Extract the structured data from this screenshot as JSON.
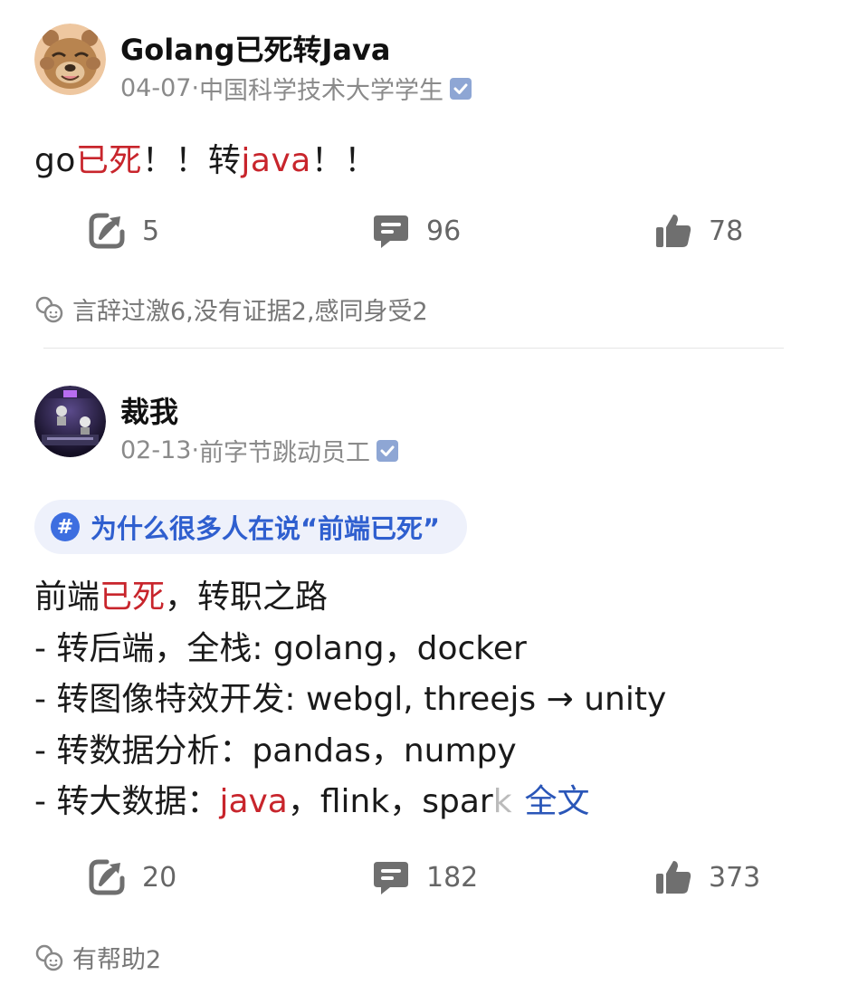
{
  "posts": [
    {
      "author": "Golang已死转Java",
      "date": "04-07",
      "affiliation": "中国科学技术大学学生",
      "content": {
        "seg1": "go",
        "seg2": "已死",
        "seg3": "！！转",
        "seg4": "java",
        "seg5": "！！"
      },
      "stats": {
        "shares": "5",
        "comments": "96",
        "likes": "78"
      },
      "reactions": "言辞过激6,没有证据2,感同身受2"
    },
    {
      "author": "裁我",
      "date": "02-13",
      "affiliation": "前字节跳动员工",
      "topic": "为什么很多人在说“前端已死”",
      "content": {
        "line1_a": "前端",
        "line1_b": "已死",
        "line1_c": "，转职之路",
        "line2": "- 转后端，全栈: golang，docker",
        "line3": "- 转图像特效开发: webgl, threejs → unity",
        "line4": "- 转数据分析：pandas，numpy",
        "line5_a": "- 转大数据：",
        "line5_b": "java",
        "line5_c": "，flink，spar",
        "line5_d": "k",
        "more_label": "全文"
      },
      "stats": {
        "shares": "20",
        "comments": "182",
        "likes": "373"
      },
      "reactions": "有帮助2"
    }
  ],
  "colors": {
    "highlight_red": "#c8252c",
    "link_blue": "#2a56b8",
    "topic_bg": "#eef1fb",
    "topic_blue": "#2f5fcf",
    "meta_gray": "#8a8a8a"
  },
  "icons": {
    "share": "share-arrow-icon",
    "comment": "comment-bubble-icon",
    "like": "thumbs-up-icon",
    "reaction": "reaction-face-icon",
    "verified": "verified-check-icon",
    "topic": "hashtag-icon"
  }
}
